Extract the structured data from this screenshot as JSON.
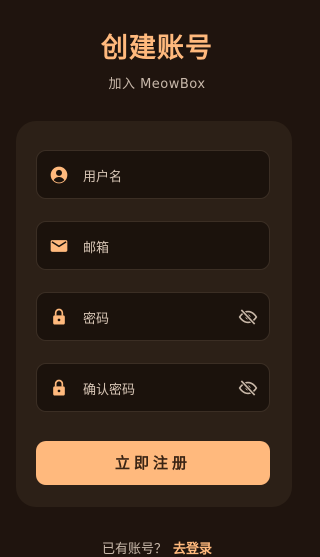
{
  "header": {
    "title": "创建账号",
    "subtitle": "加入 MeowBox"
  },
  "form": {
    "username_placeholder": "用户名",
    "email_placeholder": "邮箱",
    "password_placeholder": "密码",
    "confirm_password_placeholder": "确认密码",
    "submit_label": "立即注册"
  },
  "footer": {
    "prompt": "已有账号？",
    "login_link": "去登录"
  },
  "icons": {
    "username": "account-circle-icon",
    "email": "mail-icon",
    "password": "lock-icon",
    "confirm_password": "lock-icon",
    "visibility_toggle": "eye-off-icon"
  },
  "colors": {
    "background": "#1f140e",
    "card": "#2c2017",
    "accent": "#ffb97d",
    "field_background": "#1b120c"
  }
}
